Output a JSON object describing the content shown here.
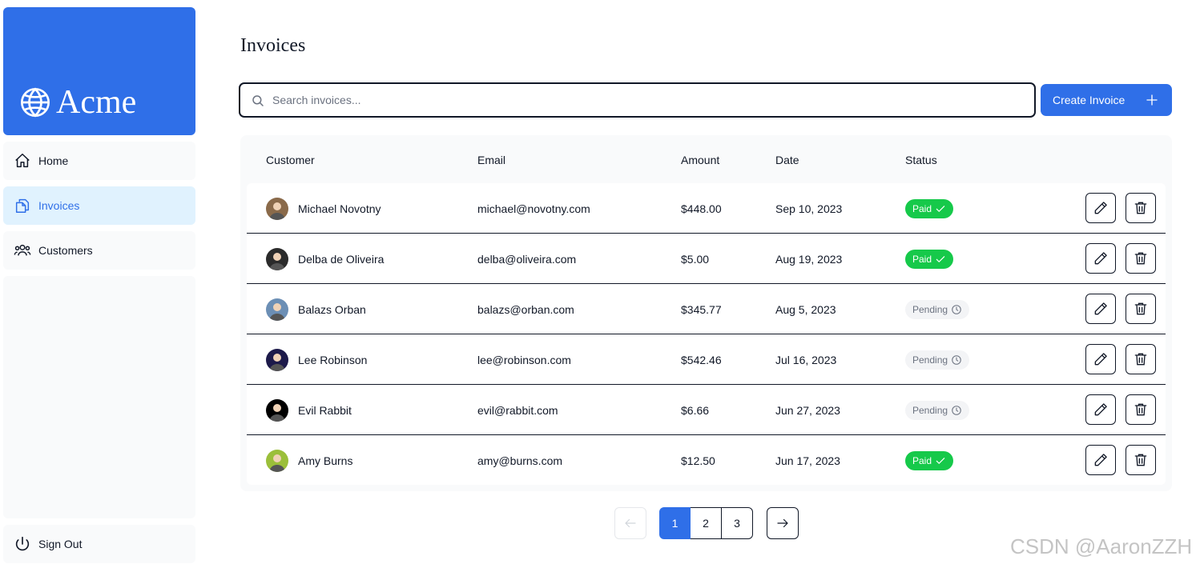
{
  "brand": {
    "name": "Acme",
    "color": "#2f6fe8"
  },
  "sidebar": {
    "items": [
      {
        "label": "Home",
        "icon": "home-icon"
      },
      {
        "label": "Invoices",
        "icon": "document-duplicate-icon",
        "active": true
      },
      {
        "label": "Customers",
        "icon": "user-group-icon"
      }
    ],
    "sign_out": "Sign Out"
  },
  "page": {
    "title": "Invoices"
  },
  "search": {
    "placeholder": "Search invoices..."
  },
  "create_button": {
    "label": "Create Invoice"
  },
  "table": {
    "headers": [
      "Customer",
      "Email",
      "Amount",
      "Date",
      "Status"
    ],
    "rows": [
      {
        "name": "Michael Novotny",
        "email": "michael@novotny.com",
        "amount": "$448.00",
        "date": "Sep 10, 2023",
        "status": "Paid",
        "avatar": "#8a6a4a"
      },
      {
        "name": "Delba de Oliveira",
        "email": "delba@oliveira.com",
        "amount": "$5.00",
        "date": "Aug 19, 2023",
        "status": "Paid",
        "avatar": "#2b2b2b"
      },
      {
        "name": "Balazs Orban",
        "email": "balazs@orban.com",
        "amount": "$345.77",
        "date": "Aug 5, 2023",
        "status": "Pending",
        "avatar": "#6c8fb5"
      },
      {
        "name": "Lee Robinson",
        "email": "lee@robinson.com",
        "amount": "$542.46",
        "date": "Jul 16, 2023",
        "status": "Pending",
        "avatar": "#1d1a4a"
      },
      {
        "name": "Evil Rabbit",
        "email": "evil@rabbit.com",
        "amount": "$6.66",
        "date": "Jun 27, 2023",
        "status": "Pending",
        "avatar": "#000000"
      },
      {
        "name": "Amy Burns",
        "email": "amy@burns.com",
        "amount": "$12.50",
        "date": "Jun 17, 2023",
        "status": "Paid",
        "avatar": "#9bbf3a"
      }
    ]
  },
  "pagination": {
    "pages": [
      "1",
      "2",
      "3"
    ],
    "current": "1"
  },
  "status_colors": {
    "paid": "#16c94a",
    "pending": "#f3f4f6"
  },
  "watermark": "CSDN @AaronZZH"
}
